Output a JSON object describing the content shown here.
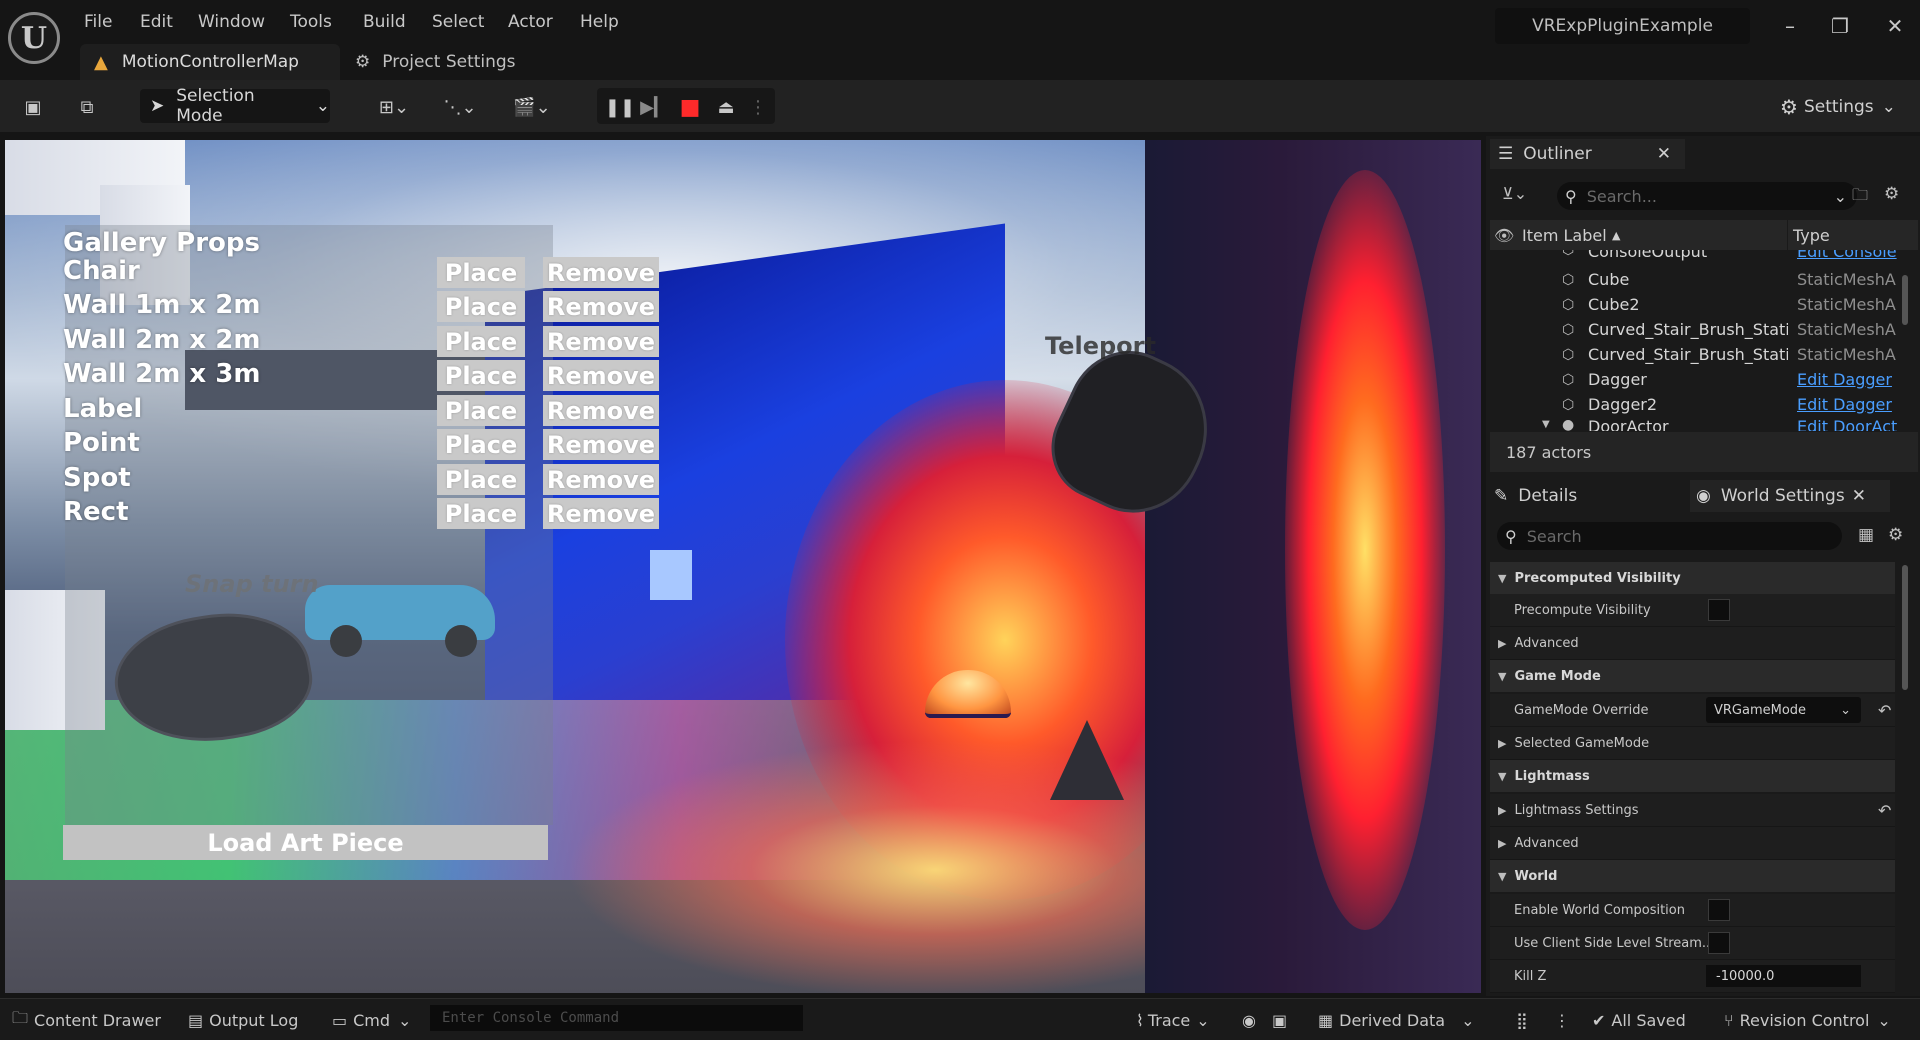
{
  "menu": [
    "File",
    "Edit",
    "Window",
    "Tools",
    "Build",
    "Select",
    "Actor",
    "Help"
  ],
  "project_name": "VRExpPluginExample",
  "tabs": {
    "map": "MotionControllerMap",
    "project_settings": "Project Settings"
  },
  "toolbar": {
    "selection_mode": "Selection Mode",
    "settings": "Settings"
  },
  "viewport": {
    "gallery_title": "Gallery Props",
    "props": [
      "Chair",
      "Wall 1m x 2m",
      "Wall 2m x 2m",
      "Wall 2m x 3m",
      "Label",
      "Point",
      "Spot",
      "Rect"
    ],
    "place_label": "Place",
    "remove_label": "Remove",
    "load_art": "Load Art Piece",
    "teleport_label": "Teleport",
    "snap_turn_label": "Snap turn"
  },
  "outliner": {
    "tab": "Outliner",
    "search_placeholder": "Search...",
    "col_label": "Item Label",
    "col_type": "Type",
    "rows": [
      {
        "name": "ConsoleOutput",
        "type": "Edit Console",
        "link": true
      },
      {
        "name": "Cube",
        "type": "StaticMeshA",
        "link": false
      },
      {
        "name": "Cube2",
        "type": "StaticMeshA",
        "link": false
      },
      {
        "name": "Curved_Stair_Brush_Static",
        "type": "StaticMeshA",
        "link": false
      },
      {
        "name": "Curved_Stair_Brush_Static",
        "type": "StaticMeshA",
        "link": false
      },
      {
        "name": "Dagger",
        "type": "Edit Dagger",
        "link": true
      },
      {
        "name": "Dagger2",
        "type": "Edit Dagger",
        "link": true
      },
      {
        "name": "DoorActor",
        "type": "Edit DoorAct",
        "link": true
      }
    ],
    "actor_count": "187 actors"
  },
  "details": {
    "details_tab": "Details",
    "world_settings_tab": "World Settings",
    "search_placeholder": "Search",
    "precomputed_visibility": "Precomputed Visibility",
    "precompute_visibility": "Precompute Visibility",
    "advanced": "Advanced",
    "game_mode": "Game Mode",
    "gamemode_override": "GameMode Override",
    "gamemode_value": "VRGameMode",
    "selected_gamemode": "Selected GameMode",
    "lightmass": "Lightmass",
    "lightmass_settings": "Lightmass Settings",
    "advanced2": "Advanced",
    "world": "World",
    "enable_world_composition": "Enable World Composition",
    "use_client_side": "Use Client Side Level Stream...",
    "kill_z": "Kill Z",
    "kill_z_value": "-10000.0"
  },
  "statusbar": {
    "content_drawer": "Content Drawer",
    "output_log": "Output Log",
    "cmd": "Cmd",
    "console_placeholder": "Enter Console Command",
    "trace": "Trace",
    "derived_data": "Derived Data",
    "all_saved": "All Saved",
    "revision_control": "Revision Control"
  }
}
